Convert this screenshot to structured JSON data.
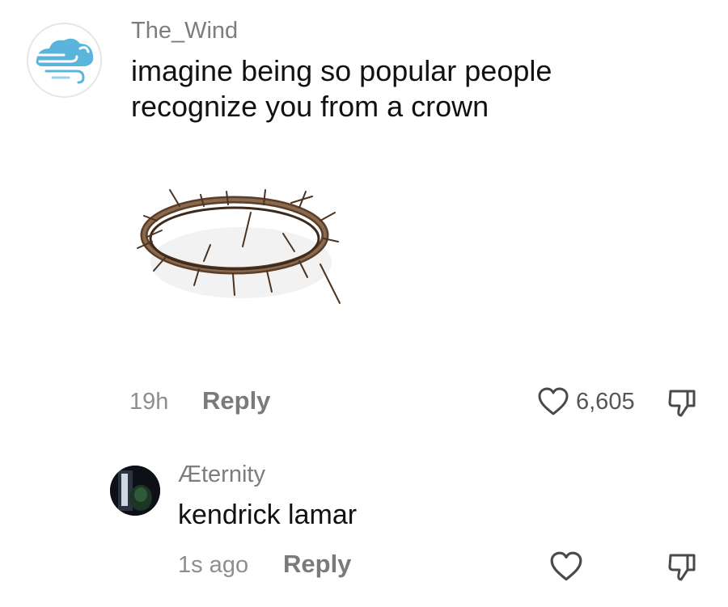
{
  "comments": [
    {
      "username": "The_Wind",
      "text": "imagine being so popular people recognize you from a crown",
      "time": "19h",
      "reply_label": "Reply",
      "like_count": "6,605",
      "avatar_icon": "wind-cloud-icon",
      "attachment_icon": "crown-of-thorns-image"
    },
    {
      "username": "Æternity",
      "text": "kendrick lamar",
      "time": "1s ago",
      "reply_label": "Reply",
      "avatar_icon": "dark-portrait-avatar"
    }
  ],
  "colors": {
    "username": "#7d7d7d",
    "meta": "#8e8e8e",
    "reply": "#7a7a7a",
    "text": "#111111",
    "icon_stroke": "#4a4a4a",
    "avatar_blue": "#5ab4dc"
  }
}
